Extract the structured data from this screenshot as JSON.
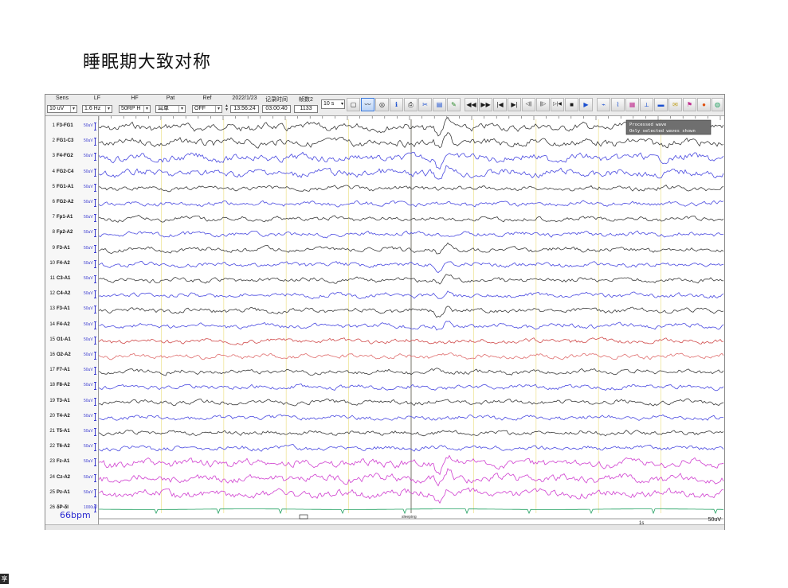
{
  "slide": {
    "title": "睡眠期大致对称"
  },
  "toolbar": {
    "sens": {
      "label": "Sens",
      "value": "10 uV"
    },
    "lf": {
      "label": "LF",
      "value": "1.6 Hz"
    },
    "hf": {
      "label": "HF",
      "value": "50RP H"
    },
    "pat": {
      "label": "Pat",
      "value": "耳单"
    },
    "ref": {
      "label": "Ref",
      "value": "OFF"
    },
    "date": {
      "label": "2022/1/23",
      "value": "13:56:24"
    },
    "record_time": {
      "label": "记录时间",
      "value": "03:00:40"
    },
    "page": {
      "label": "帧数2",
      "value": "1133"
    },
    "period": "10 s",
    "icons": [
      "open-icon",
      "wave-edit-icon",
      "montage-icon",
      "info-icon",
      "print-icon",
      "cut-icon",
      "spectrum-icon",
      "marker-icon"
    ],
    "nav_glyphs": [
      "◀◀",
      "▶▶",
      "|◀",
      "▶|",
      "◁||",
      "||▷",
      "▷|◀",
      "■",
      "▶"
    ],
    "tool_icons": [
      "analysis-icon",
      "trend-icon",
      "report-icon",
      "measure-icon",
      "ruler-icon",
      "note-icon",
      "tag-icon",
      "color-icon",
      "map-icon",
      "help-icon"
    ]
  },
  "channels": [
    {
      "num": "1",
      "name": "F3-FG1",
      "scale": "50uV",
      "color": "#3a3a3a"
    },
    {
      "num": "2",
      "name": "FG1-C3",
      "scale": "50uV",
      "color": "#3a3a3a"
    },
    {
      "num": "3",
      "name": "F4-FG2",
      "scale": "50uV",
      "color": "#4a4ae0"
    },
    {
      "num": "4",
      "name": "FG2-C4",
      "scale": "50uV",
      "color": "#4a4ae0"
    },
    {
      "num": "5",
      "name": "FG1-A1",
      "scale": "50uV",
      "color": "#3a3a3a"
    },
    {
      "num": "6",
      "name": "FG2-A2",
      "scale": "50uV",
      "color": "#4a4ae0"
    },
    {
      "num": "7",
      "name": "Fp1-A1",
      "scale": "50uV",
      "color": "#3a3a3a"
    },
    {
      "num": "8",
      "name": "Fp2-A2",
      "scale": "50uV",
      "color": "#4a4ae0"
    },
    {
      "num": "9",
      "name": "F3-A1",
      "scale": "50uV",
      "color": "#3a3a3a"
    },
    {
      "num": "10",
      "name": "F4-A2",
      "scale": "50uV",
      "color": "#4a4ae0"
    },
    {
      "num": "11",
      "name": "C3-A1",
      "scale": "50uV",
      "color": "#3a3a3a"
    },
    {
      "num": "12",
      "name": "C4-A2",
      "scale": "50uV",
      "color": "#4a4ae0"
    },
    {
      "num": "13",
      "name": "F3-A1",
      "scale": "50uV",
      "color": "#3a3a3a"
    },
    {
      "num": "14",
      "name": "F4-A2",
      "scale": "50uV",
      "color": "#4a4ae0"
    },
    {
      "num": "15",
      "name": "O1-A1",
      "scale": "50uV",
      "color": "#d04a4a"
    },
    {
      "num": "16",
      "name": "O2-A2",
      "scale": "50uV",
      "color": "#e07070"
    },
    {
      "num": "17",
      "name": "F7-A1",
      "scale": "50uV",
      "color": "#3a3a3a"
    },
    {
      "num": "18",
      "name": "F8-A2",
      "scale": "50uV",
      "color": "#4a4ae0"
    },
    {
      "num": "19",
      "name": "T3-A1",
      "scale": "50uV",
      "color": "#3a3a3a"
    },
    {
      "num": "20",
      "name": "T4-A2",
      "scale": "50uV",
      "color": "#4a4ae0"
    },
    {
      "num": "21",
      "name": "T5-A1",
      "scale": "50uV",
      "color": "#3a3a3a"
    },
    {
      "num": "22",
      "name": "T6-A2",
      "scale": "50uV",
      "color": "#4a4ae0"
    },
    {
      "num": "23",
      "name": "Fz-A1",
      "scale": "50uV",
      "color": "#d040d0"
    },
    {
      "num": "24",
      "name": "Cz-A2",
      "scale": "50uV",
      "color": "#d040d0"
    },
    {
      "num": "25",
      "name": "Pz-A1",
      "scale": "50uV",
      "color": "#d040d0"
    },
    {
      "num": "26",
      "name": "δP-δI",
      "scale": "1000uV",
      "color": "#20a060"
    }
  ],
  "heart_rate": "66bpm",
  "overlay": {
    "line1": "Processed wave",
    "line2": "Only selected waves shown"
  },
  "event_label": "sleeping",
  "scale_label": "50uV",
  "location_label": "1s",
  "corner_glyph": "享"
}
